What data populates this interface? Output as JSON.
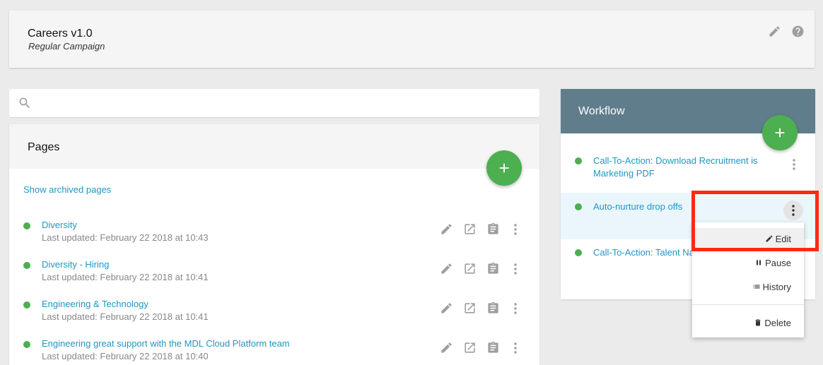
{
  "header": {
    "title": "Careers v1.0",
    "subtitle": "Regular Campaign",
    "icons": [
      "pencil-icon",
      "help-icon"
    ]
  },
  "search": {
    "value": "",
    "placeholder": ""
  },
  "pages": {
    "title": "Pages",
    "archived_link": "Show archived pages",
    "status_color": "#4caf50",
    "items": [
      {
        "name": "Diversity",
        "updated": "Last updated: February 22 2018 at 10:43"
      },
      {
        "name": "Diversity - Hiring",
        "updated": "Last updated: February 22 2018 at 10:41"
      },
      {
        "name": "Engineering & Technology",
        "updated": "Last updated: February 22 2018 at 10:41"
      },
      {
        "name": "Engineering great support with the MDL Cloud Platform team",
        "updated": "Last updated: February 22 2018 at 10:40"
      }
    ],
    "row_icons": [
      "pencil-icon",
      "open-external-icon",
      "clipboard-icon",
      "kebab-icon"
    ]
  },
  "workflow": {
    "title": "Workflow",
    "header_color": "#607d8b",
    "items": [
      {
        "name": "Call-To-Action: Download Recruitment is Marketing PDF"
      },
      {
        "name": "Auto-nurture drop offs"
      },
      {
        "name": "Call-To-Action: Talent Na"
      }
    ]
  },
  "dropdown": {
    "items": [
      {
        "label": "Edit",
        "icon": "pencil-icon"
      },
      {
        "label": "Pause",
        "icon": "pause-icon"
      },
      {
        "label": "History",
        "icon": "list-icon"
      },
      {
        "label": "Delete",
        "icon": "trash-icon"
      }
    ]
  },
  "colors": {
    "accent_green": "#4caf50",
    "link_blue": "#2196c3",
    "highlight_red": "#ff2a12"
  }
}
